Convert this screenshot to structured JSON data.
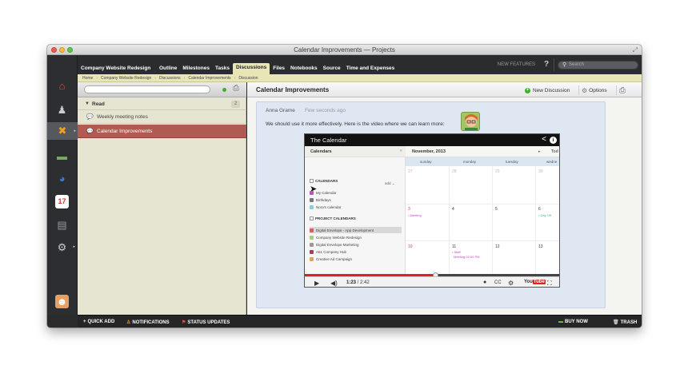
{
  "window": {
    "title": "Calendar Improvements — Projects"
  },
  "nav": {
    "project": "Company Website Redesign",
    "tabs": [
      "Outline",
      "Milestones",
      "Tasks",
      "Discussions",
      "Files",
      "Notebooks",
      "Source",
      "Time and Expenses"
    ],
    "active_tab": "Discussions",
    "new_features": "NEW FEATURES",
    "help": "?",
    "search_placeholder": "Search"
  },
  "breadcrumb": [
    "Home",
    "Company Website Redesign",
    "Discussions",
    "Calendar Improvements",
    "Discussion"
  ],
  "sidebar": {
    "section": {
      "label": "Read",
      "count": "2"
    },
    "items": [
      {
        "label": "Weekly meeting notes",
        "selected": false
      },
      {
        "label": "Calendar Improvements",
        "selected": true
      }
    ]
  },
  "main": {
    "title": "Calendar Improvements",
    "new_discussion": "New Discussion",
    "options": "Options",
    "post": {
      "author": "Anna Grame",
      "time": "Few seconds ago",
      "text": "We should use it more effectively. Here is the video where we can learn more:"
    }
  },
  "video": {
    "title": "The Calendar",
    "calendars_header": "Calendars",
    "calendars_section": "CALENDARS",
    "add": "add",
    "my_calendars": [
      {
        "name": "My Calendar",
        "color": "#c050c0"
      },
      {
        "name": "Birthdays",
        "color": "#777777"
      },
      {
        "name": "Nora's calendar",
        "color": "#7fd0e0"
      }
    ],
    "project_section": "PROJECT CALENDARS",
    "project_calendars": [
      {
        "name": "Digital Envelope - App Development",
        "color": "#d86060",
        "highlight": true
      },
      {
        "name": "Company Website Redesign",
        "color": "#a8d070",
        "highlight": false
      },
      {
        "name": "Digital Envelope Marketing",
        "color": "#999999",
        "highlight": false
      },
      {
        "name": "A51 Company Hub",
        "color": "#c03060",
        "highlight": false
      },
      {
        "name": "Creative Ad Campaign",
        "color": "#e8a060",
        "highlight": false
      }
    ],
    "month": "November, 2013",
    "today": "Tod",
    "days": [
      "sunday",
      "monday",
      "tuesday",
      "wedne"
    ],
    "weeks": [
      [
        "27",
        "28",
        "29",
        "30"
      ],
      [
        "3",
        "4",
        "5",
        "6"
      ],
      [
        "10",
        "11",
        "12",
        "13"
      ]
    ],
    "events": {
      "meeting": "• Meeting",
      "day_off": "• Day Off",
      "staff": "• Staff",
      "staff2": "Meeting 02:00 PM"
    },
    "time_current": "1:23",
    "time_total": "2:42",
    "progress": 0.51,
    "youtube": "You",
    "youtube_tube": "Tube"
  },
  "footer": {
    "quick_add": "QUICK ADD",
    "notifications": "NOTIFICATIONS",
    "status_updates": "STATUS UPDATES",
    "buy_now": "BUY NOW",
    "trash": "TRASH"
  },
  "colors": {
    "accent_red": "#b05a52",
    "active_tab_bg": "#e8e6b6",
    "green": "#3fae2a"
  }
}
